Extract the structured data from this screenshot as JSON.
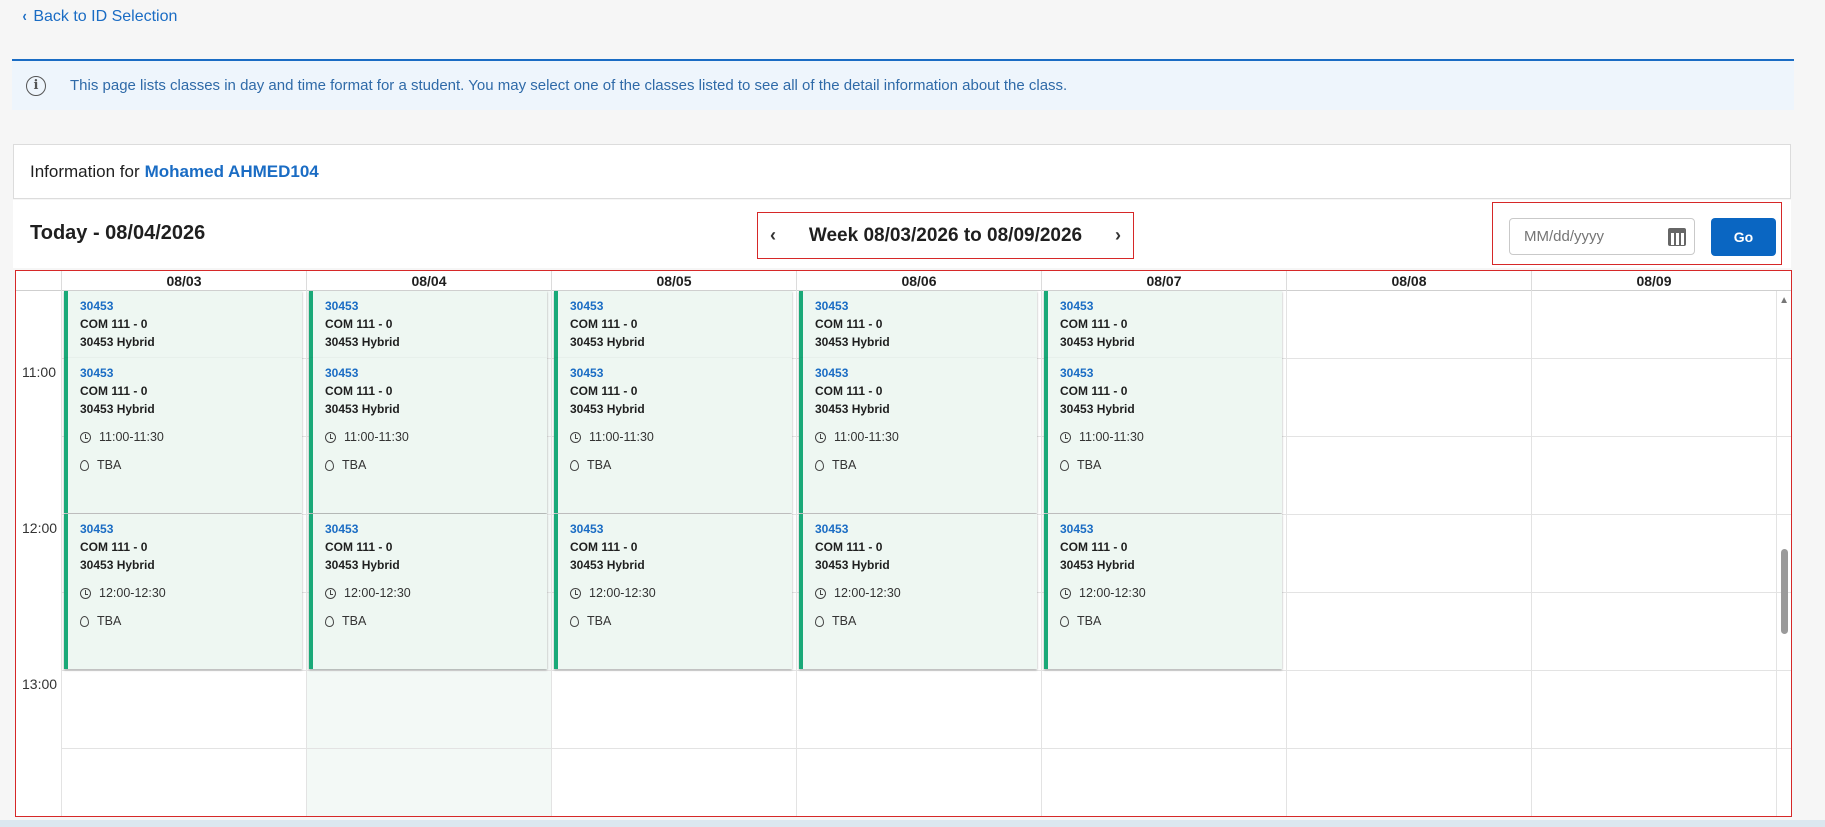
{
  "nav": {
    "back_label": "Back to ID Selection"
  },
  "notice": {
    "text": "This page lists classes in day and time format for a student. You may select one of the classes listed to see all of the detail information about the class."
  },
  "info": {
    "prefix": "Information for",
    "student_name": "Mohamed AHMED104"
  },
  "toolbar": {
    "today_label": "Today - 08/04/2026",
    "week_label": "Week 08/03/2026 to 08/09/2026",
    "date_placeholder": "MM/dd/yyyy",
    "go_label": "Go"
  },
  "calendar": {
    "days": [
      "08/03",
      "08/04",
      "08/05",
      "08/06",
      "08/07",
      "08/08",
      "08/09"
    ],
    "times": [
      "11:00",
      "12:00",
      "13:00"
    ],
    "events_top": {
      "crn": "30453",
      "course": "COM 111 - 0",
      "section": "30453 Hybrid"
    },
    "events_1100": {
      "crn": "30453",
      "course": "COM 111 - 0",
      "section": "30453 Hybrid",
      "time": "11:00-11:30",
      "location": "TBA"
    },
    "events_1200": {
      "crn": "30453",
      "course": "COM 111 - 0",
      "section": "30453 Hybrid",
      "time": "12:00-12:30",
      "location": "TBA"
    }
  },
  "colors": {
    "accent": "#1a6cc4",
    "event_bar": "#1aa978",
    "event_bg": "#eef7f2",
    "highlight_border": "#d62828",
    "go_button": "#0a66c2"
  }
}
